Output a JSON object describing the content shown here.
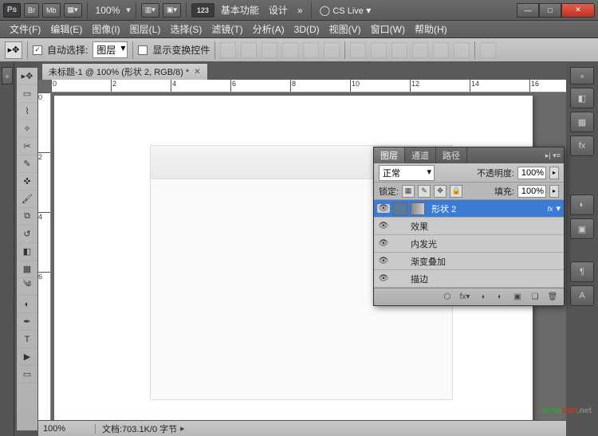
{
  "appbar": {
    "logo": "Ps",
    "br": "Br",
    "mb": "Mb",
    "zoom": "100%",
    "num": "123",
    "ws1": "基本功能",
    "ws2": "设计",
    "more": "»",
    "cslive": "CS Live"
  },
  "menu": [
    "文件(F)",
    "编辑(E)",
    "图像(I)",
    "图层(L)",
    "选择(S)",
    "滤镜(T)",
    "分析(A)",
    "3D(D)",
    "视图(V)",
    "窗口(W)",
    "帮助(H)"
  ],
  "options": {
    "auto_select": "自动选择:",
    "layer": "图层",
    "show_transform": "显示变换控件"
  },
  "doc": {
    "tab": "未标题-1 @ 100% (形状 2, RGB/8) *"
  },
  "ruler_h": [
    "0",
    "2",
    "4",
    "6",
    "8",
    "10",
    "12",
    "14",
    "16"
  ],
  "ruler_v": [
    "0",
    "2",
    "4",
    "6"
  ],
  "status": {
    "zoom": "100%",
    "doc": "文档:703.1K/0 字节"
  },
  "panel": {
    "tabs": [
      "图层",
      "通道",
      "路径"
    ],
    "blend": "正常",
    "opacity_label": "不透明度:",
    "opacity": "100%",
    "lock_label": "锁定:",
    "fill_label": "填充:",
    "fill": "100%",
    "layer_name": "形状 2",
    "fx": "fx",
    "effects": "效果",
    "inner_glow": "内发光",
    "grad": "渐变叠加",
    "stroke": "描边"
  },
  "watermark": {
    "shan": "shan",
    "cun": "cun",
    "net": ".net"
  }
}
